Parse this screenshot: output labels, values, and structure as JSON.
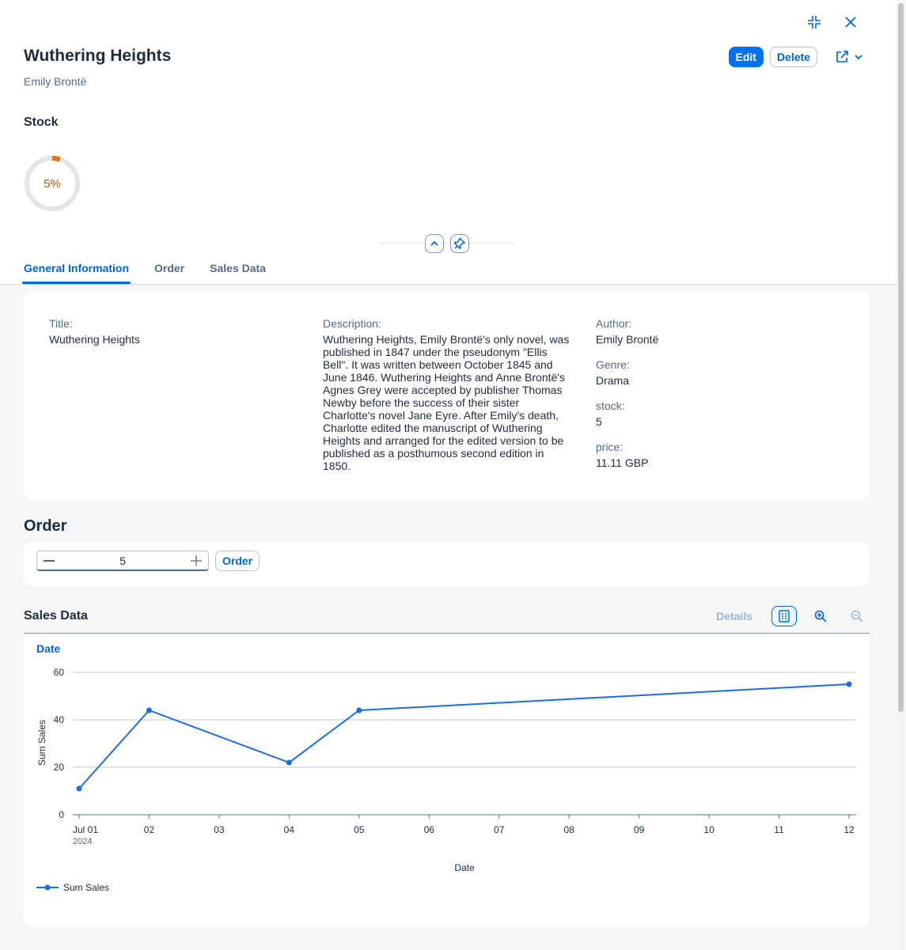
{
  "header": {
    "title": "Wuthering Heights",
    "subtitle": "Emily Brontë",
    "edit_label": "Edit",
    "delete_label": "Delete",
    "stock_label": "Stock",
    "stock_percent": "5%",
    "stock_value_fraction": 0.05
  },
  "tabs": [
    {
      "label": "General Information",
      "active": true
    },
    {
      "label": "Order",
      "active": false
    },
    {
      "label": "Sales Data",
      "active": false
    }
  ],
  "general_info": {
    "title_label": "Title:",
    "title_value": "Wuthering Heights",
    "description_label": "Description:",
    "description_value": "Wuthering Heights, Emily Brontë's only novel, was published in 1847 under the pseudonym \"Ellis Bell\". It was written between October 1845 and June 1846. Wuthering Heights and Anne Brontë's Agnes Grey were accepted by publisher Thomas Newby before the success of their sister Charlotte's novel Jane Eyre. After Emily's death, Charlotte edited the manuscript of Wuthering Heights and arranged for the edited version to be published as a posthumous second edition in 1850.",
    "author_label": "Author:",
    "author_value": "Emily Brontë",
    "genre_label": "Genre:",
    "genre_value": "Drama",
    "stock_label": "stock:",
    "stock_value": "5",
    "price_label": "price:",
    "price_value": "11.11 GBP"
  },
  "order": {
    "section_title": "Order",
    "quantity": "5",
    "button_label": "Order"
  },
  "sales": {
    "section_title": "Sales Data",
    "details_label": "Details",
    "drill_label": "Date"
  },
  "colors": {
    "accent": "#0064d9",
    "primary_button": "#0070f2",
    "series": "#1b6be6",
    "stock_indicator": "#e9730c"
  },
  "icons": [
    "exit-fullscreen-icon",
    "close-icon",
    "share-icon",
    "chevron-down-icon",
    "collapse-up-icon",
    "pin-icon",
    "table-view-icon",
    "zoom-in-icon",
    "zoom-out-icon"
  ],
  "chart_data": {
    "type": "line",
    "x": [
      "Jul 01",
      "02",
      "03",
      "04",
      "05",
      "06",
      "07",
      "08",
      "09",
      "10",
      "11",
      "12"
    ],
    "x_year_label": "2024",
    "series": [
      {
        "name": "Sum Sales",
        "points": [
          {
            "x": 1,
            "y": 11
          },
          {
            "x": 2,
            "y": 44
          },
          {
            "x": 4,
            "y": 22
          },
          {
            "x": 5,
            "y": 44
          },
          {
            "x": 12,
            "y": 55
          }
        ]
      }
    ],
    "xlabel": "Date",
    "ylabel": "Sum Sales",
    "yticks": [
      "0",
      "20",
      "40",
      "60"
    ],
    "ylim": [
      0,
      60
    ],
    "xlim": [
      1,
      12
    ],
    "grid": true,
    "legend_position": "bottom-left"
  }
}
